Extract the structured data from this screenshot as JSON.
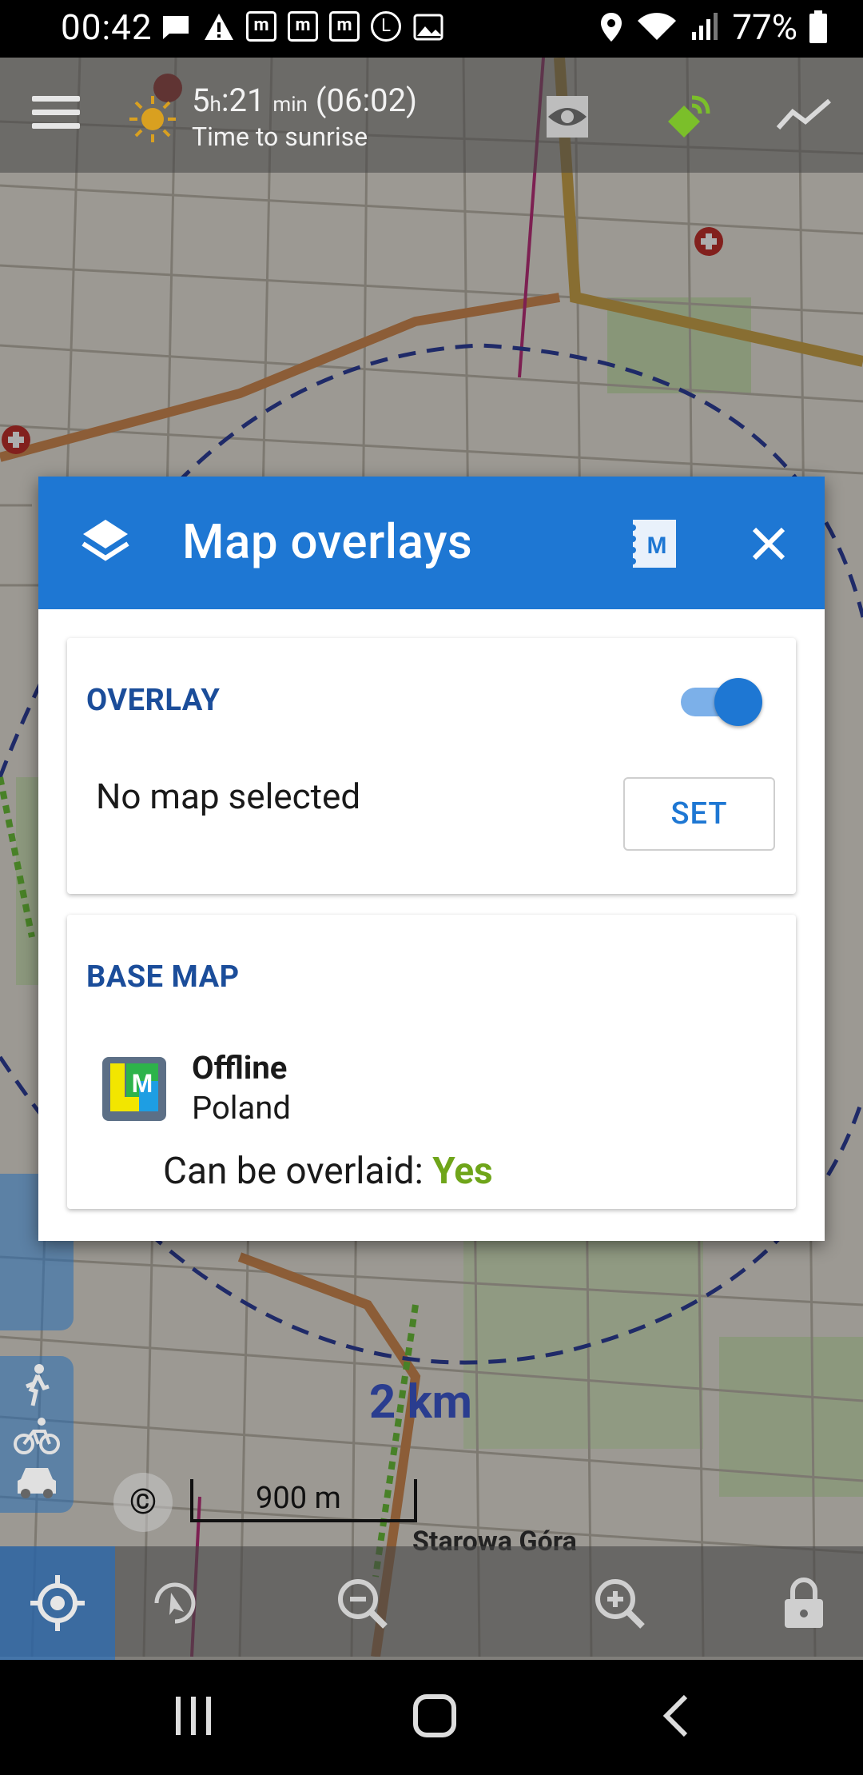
{
  "status_bar": {
    "time": "00:42",
    "battery": "77%",
    "notification_icons": [
      "message-icon",
      "warning-icon",
      "m-app-icon",
      "m-app-icon",
      "m-app-icon",
      "l-app-icon",
      "gallery-icon"
    ],
    "system_icons": [
      "location-icon",
      "wifi-icon",
      "signal-icon",
      "battery-icon"
    ]
  },
  "map_toolbar": {
    "sunrise_prefix": "5",
    "sunrise_hours_unit": "h",
    "sunrise_minutes": ":21",
    "sunrise_minutes_unit": "min",
    "sunrise_clock": "(06:02)",
    "sunrise_caption": "Time to sunrise"
  },
  "map": {
    "km_label": "2 km",
    "scale_label": "900 m",
    "place_label": "Starowa Góra",
    "copyright_symbol": "©"
  },
  "dialog": {
    "title": "Map overlays",
    "overlay_section": {
      "title": "OVERLAY",
      "enabled": true,
      "status": "No map selected",
      "set_label": "SET"
    },
    "basemap_section": {
      "title": "BASE MAP",
      "map_type": "Offline",
      "map_name": "Poland",
      "overlaid_label": "Can be overlaid:",
      "overlaid_value": "Yes"
    }
  },
  "colors": {
    "header_blue": "#1e77d3",
    "section_title": "#1b4d9a",
    "yes_green": "#6fa51a"
  }
}
